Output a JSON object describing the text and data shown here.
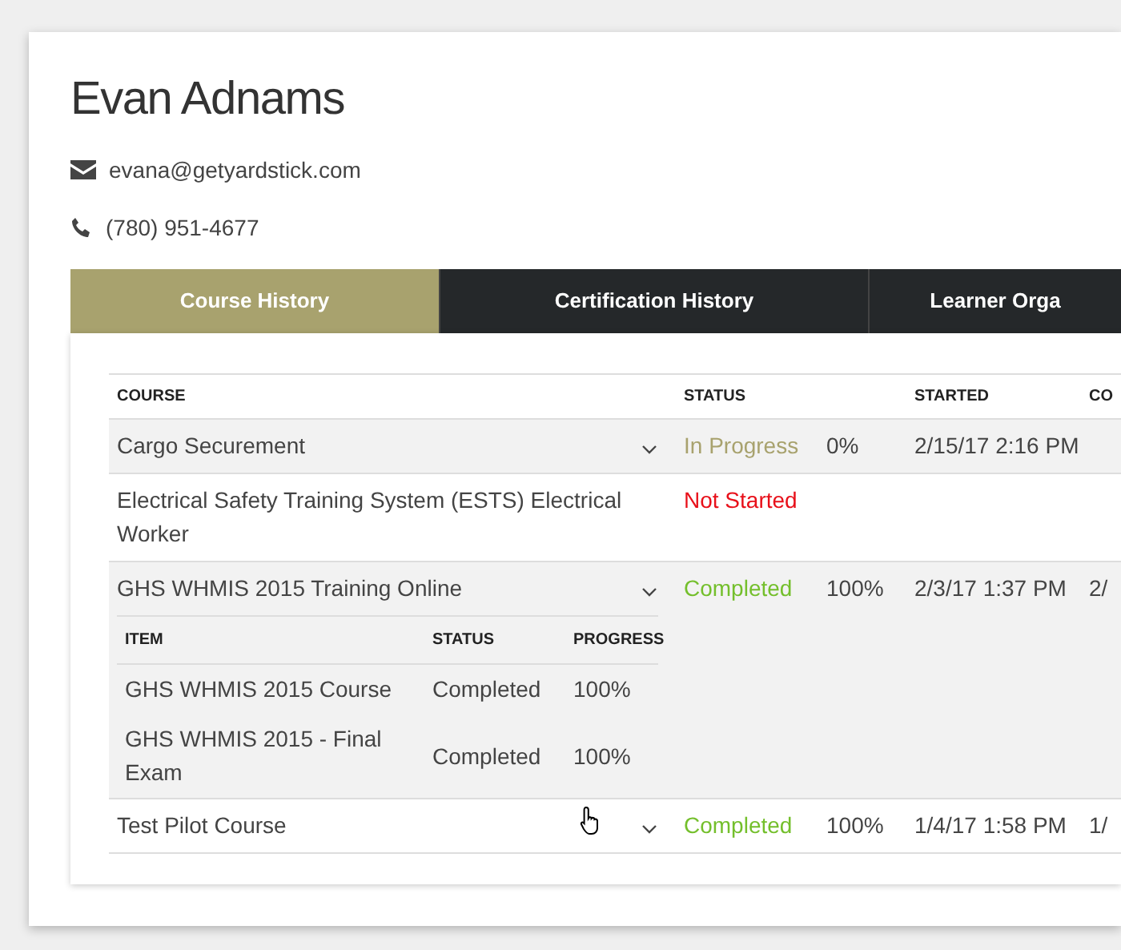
{
  "learner": {
    "name": "Evan Adnams",
    "email": "evana@getyardstick.com",
    "phone": "(780) 951-4677"
  },
  "tabs": [
    {
      "label": "Course History",
      "selected": true
    },
    {
      "label": "Certification History",
      "selected": false
    },
    {
      "label": "Learner Orga",
      "selected": false
    }
  ],
  "table": {
    "columns": [
      "COURSE",
      "STATUS",
      "",
      "STARTED",
      "CO"
    ],
    "rows": [
      {
        "course": "Cargo Securement",
        "status": "In Progress",
        "color": "#a8a26e",
        "progress": "0%",
        "started": "2/15/17 2:16 PM",
        "column_5": "",
        "expandable": true,
        "expanded": false,
        "highlighted": true
      },
      {
        "course": "Electrical Safety Training System (ESTS) Electrical Worker",
        "status": "Not Started",
        "color": "#e8101a",
        "progress": "",
        "started": "",
        "column_5": "",
        "expandable": false,
        "highlighted": false
      },
      {
        "course": "GHS WHMIS 2015 Training Online",
        "status": "Completed",
        "color": "#74bf2c",
        "progress": "100%",
        "started": "2/3/17 1:37 PM",
        "column_5": "2/",
        "expandable": true,
        "expanded": true,
        "highlighted": true,
        "items": {
          "columns": [
            "ITEM",
            "STATUS",
            "PROGRESS"
          ],
          "rows": [
            {
              "item": "GHS WHMIS 2015 Course",
              "status": "Completed",
              "progress": "100%"
            },
            {
              "item": "GHS WHMIS 2015 - Final Exam",
              "status": "Completed",
              "progress": "100%"
            }
          ]
        }
      },
      {
        "course": "Test Pilot Course",
        "status": "Completed",
        "color": "#74bf2c",
        "progress": "100%",
        "started": "1/4/17 1:58 PM",
        "column_5": "1/",
        "expandable": true,
        "expanded": false,
        "highlighted": false
      }
    ]
  }
}
